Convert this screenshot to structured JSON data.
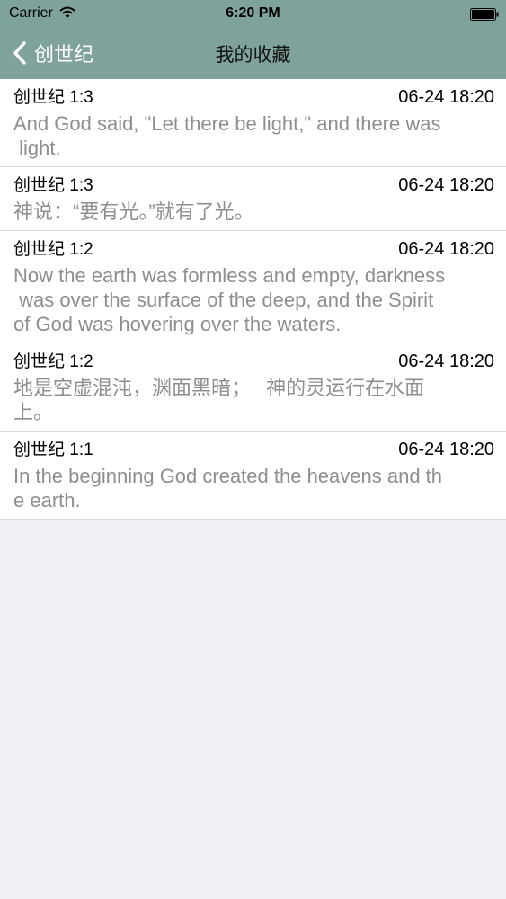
{
  "status": {
    "carrier": "Carrier",
    "time": "6:20 PM"
  },
  "navbar": {
    "back_label": "创世纪",
    "title": "我的收藏"
  },
  "favorites": [
    {
      "ref": "创世纪 1:3",
      "time": "06-24 18:20",
      "text": "And God said, \"Let there be light,\" and there was\n light."
    },
    {
      "ref": "创世纪 1:3",
      "time": "06-24 18:20",
      "text": "神说：“要有光。”就有了光。"
    },
    {
      "ref": "创世纪 1:2",
      "time": "06-24 18:20",
      "text": "Now the earth was formless and empty, darkness\n was over the surface of the deep, and the Spirit\nof God was hovering over the waters."
    },
    {
      "ref": "创世纪 1:2",
      "time": "06-24 18:20",
      "text": "地是空虚混沌，渊面黑暗；　 神的灵运行在水面\n上。"
    },
    {
      "ref": "创世纪 1:1",
      "time": "06-24 18:20",
      "text": "In the beginning God created the heavens and th\ne earth."
    }
  ],
  "colors": {
    "bar": "#7fa39c",
    "verse_text": "#8e8e8e",
    "background": "#efeff4"
  },
  "icons": [
    "wifi-icon",
    "battery-icon",
    "chevron-left-icon"
  ]
}
